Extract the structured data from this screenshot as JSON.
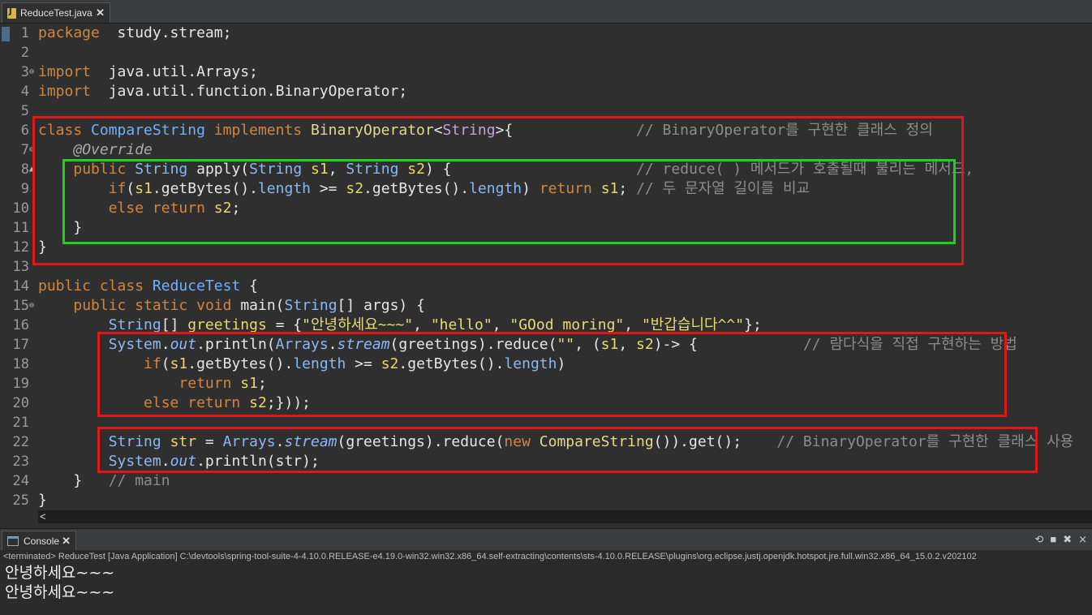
{
  "editor_tab": {
    "title": "ReduceTest.java",
    "icon": "java-file-icon"
  },
  "lines": [
    {
      "n": "1",
      "fold": "",
      "segs": [
        [
          "kw",
          "package"
        ],
        [
          "",
          "  study.stream;"
        ]
      ]
    },
    {
      "n": "2",
      "fold": "",
      "segs": []
    },
    {
      "n": "3",
      "fold": "⊖",
      "segs": [
        [
          "kw",
          "import"
        ],
        [
          "",
          "  java.util.Arrays;"
        ]
      ]
    },
    {
      "n": "4",
      "fold": "",
      "segs": [
        [
          "kw",
          "import"
        ],
        [
          "",
          "  java.util.function.BinaryOperator;"
        ]
      ]
    },
    {
      "n": "5",
      "fold": "",
      "segs": []
    },
    {
      "n": "6",
      "fold": "",
      "segs": [
        [
          "kw",
          "class"
        ],
        [
          "",
          " "
        ],
        [
          "cls",
          "CompareString"
        ],
        [
          "",
          " "
        ],
        [
          "kw",
          "implements"
        ],
        [
          "",
          " "
        ],
        [
          "iface",
          "BinaryOperator"
        ],
        [
          "",
          "<"
        ],
        [
          "gen",
          "String"
        ],
        [
          "",
          ">{"
        ],
        [
          "",
          "              "
        ],
        [
          "cmt",
          "// BinaryOperator를 구현한 클래스 정의"
        ]
      ]
    },
    {
      "n": "7",
      "fold": "⊖",
      "segs": [
        [
          "",
          "    "
        ],
        [
          "ann",
          "@Override"
        ]
      ]
    },
    {
      "n": "8",
      "fold": "▲",
      "segs": [
        [
          "",
          "    "
        ],
        [
          "kw",
          "public"
        ],
        [
          "",
          " "
        ],
        [
          "type",
          "String"
        ],
        [
          "",
          " "
        ],
        [
          "meth",
          "apply"
        ],
        [
          "",
          "("
        ],
        [
          "type",
          "String"
        ],
        [
          "",
          " "
        ],
        [
          "var",
          "s1"
        ],
        [
          "",
          ", "
        ],
        [
          "type",
          "String"
        ],
        [
          "",
          " "
        ],
        [
          "var",
          "s2"
        ],
        [
          "",
          ") {"
        ],
        [
          "",
          "                     "
        ],
        [
          "cmt",
          "// reduce( ) 메서드가 호출될때 불리는 메서드,"
        ]
      ]
    },
    {
      "n": "9",
      "fold": "",
      "segs": [
        [
          "",
          "        "
        ],
        [
          "kw",
          "if"
        ],
        [
          "",
          "("
        ],
        [
          "var",
          "s1"
        ],
        [
          "",
          ".getBytes()."
        ],
        [
          "fld2",
          "length"
        ],
        [
          "",
          " >= "
        ],
        [
          "var",
          "s2"
        ],
        [
          "",
          ".getBytes()."
        ],
        [
          "fld2",
          "length"
        ],
        [
          "",
          ") "
        ],
        [
          "kw",
          "return"
        ],
        [
          "",
          " "
        ],
        [
          "var",
          "s1"
        ],
        [
          "",
          "; "
        ],
        [
          "cmt",
          "// 두 문자열 길이를 비교"
        ]
      ]
    },
    {
      "n": "10",
      "fold": "",
      "segs": [
        [
          "",
          "        "
        ],
        [
          "kw",
          "else"
        ],
        [
          "",
          " "
        ],
        [
          "kw",
          "return"
        ],
        [
          "",
          " "
        ],
        [
          "var",
          "s2"
        ],
        [
          "",
          ";"
        ]
      ]
    },
    {
      "n": "11",
      "fold": "",
      "segs": [
        [
          "",
          "    }"
        ]
      ]
    },
    {
      "n": "12",
      "fold": "",
      "segs": [
        [
          "",
          "}"
        ]
      ]
    },
    {
      "n": "13",
      "fold": "",
      "segs": []
    },
    {
      "n": "14",
      "fold": "",
      "segs": [
        [
          "kw",
          "public"
        ],
        [
          "",
          " "
        ],
        [
          "kw",
          "class"
        ],
        [
          "",
          " "
        ],
        [
          "cls",
          "ReduceTest"
        ],
        [
          "",
          " {"
        ]
      ]
    },
    {
      "n": "15",
      "fold": "⊖",
      "segs": [
        [
          "",
          "    "
        ],
        [
          "kw",
          "public"
        ],
        [
          "",
          " "
        ],
        [
          "kw",
          "static"
        ],
        [
          "",
          " "
        ],
        [
          "kw",
          "void"
        ],
        [
          "",
          " "
        ],
        [
          "meth",
          "main"
        ],
        [
          "",
          "("
        ],
        [
          "type",
          "String"
        ],
        [
          "",
          "[] "
        ],
        [
          "meth",
          "args"
        ],
        [
          "",
          ") {"
        ]
      ]
    },
    {
      "n": "16",
      "fold": "",
      "segs": [
        [
          "",
          "        "
        ],
        [
          "type",
          "String"
        ],
        [
          "",
          "[] "
        ],
        [
          "var",
          "greetings"
        ],
        [
          "",
          " = {"
        ],
        [
          "str",
          "\"안녕하세요~~~\""
        ],
        [
          "",
          ", "
        ],
        [
          "str",
          "\"hello\""
        ],
        [
          "",
          ", "
        ],
        [
          "str",
          "\"GOod moring\""
        ],
        [
          "",
          ", "
        ],
        [
          "str",
          "\"반갑습니다^^\""
        ],
        [
          "",
          "};"
        ]
      ]
    },
    {
      "n": "17",
      "fold": "",
      "segs": [
        [
          "",
          "        "
        ],
        [
          "type",
          "System"
        ],
        [
          "",
          "."
        ],
        [
          "fld",
          "out"
        ],
        [
          "",
          ".println("
        ],
        [
          "type",
          "Arrays"
        ],
        [
          "",
          "."
        ],
        [
          "fld",
          "stream"
        ],
        [
          "",
          "(greetings).reduce("
        ],
        [
          "str",
          "\"\""
        ],
        [
          "",
          ", ("
        ],
        [
          "var",
          "s1"
        ],
        [
          "",
          ", "
        ],
        [
          "var",
          "s2"
        ],
        [
          "",
          ")-> {"
        ],
        [
          "",
          "            "
        ],
        [
          "cmt",
          "// 람다식을 직접 구현하는 방법"
        ]
      ]
    },
    {
      "n": "18",
      "fold": "",
      "segs": [
        [
          "",
          "            "
        ],
        [
          "kw",
          "if"
        ],
        [
          "",
          "("
        ],
        [
          "var",
          "s1"
        ],
        [
          "",
          ".getBytes()."
        ],
        [
          "fld2",
          "length"
        ],
        [
          "",
          " >= "
        ],
        [
          "var",
          "s2"
        ],
        [
          "",
          ".getBytes()."
        ],
        [
          "fld2",
          "length"
        ],
        [
          "",
          ")"
        ]
      ]
    },
    {
      "n": "19",
      "fold": "",
      "segs": [
        [
          "",
          "                "
        ],
        [
          "kw",
          "return"
        ],
        [
          "",
          " "
        ],
        [
          "var",
          "s1"
        ],
        [
          "",
          ";"
        ]
      ]
    },
    {
      "n": "20",
      "fold": "",
      "segs": [
        [
          "",
          "            "
        ],
        [
          "kw",
          "else"
        ],
        [
          "",
          " "
        ],
        [
          "kw",
          "return"
        ],
        [
          "",
          " "
        ],
        [
          "var",
          "s2"
        ],
        [
          "",
          ";}));"
        ]
      ]
    },
    {
      "n": "21",
      "fold": "",
      "segs": []
    },
    {
      "n": "22",
      "fold": "",
      "segs": [
        [
          "",
          "        "
        ],
        [
          "type",
          "String"
        ],
        [
          "",
          " "
        ],
        [
          "var",
          "str"
        ],
        [
          "",
          " = "
        ],
        [
          "type",
          "Arrays"
        ],
        [
          "",
          "."
        ],
        [
          "fld",
          "stream"
        ],
        [
          "",
          "(greetings).reduce("
        ],
        [
          "kw",
          "new"
        ],
        [
          "",
          " "
        ],
        [
          "iface",
          "CompareString"
        ],
        [
          "",
          "()).get();"
        ],
        [
          "",
          "    "
        ],
        [
          "cmt",
          "// BinaryOperator를 구현한 클래스 사용"
        ]
      ]
    },
    {
      "n": "23",
      "fold": "",
      "segs": [
        [
          "",
          "        "
        ],
        [
          "type",
          "System"
        ],
        [
          "",
          "."
        ],
        [
          "fld",
          "out"
        ],
        [
          "",
          ".println(str);"
        ]
      ]
    },
    {
      "n": "24",
      "fold": "",
      "segs": [
        [
          "",
          "    }"
        ],
        [
          "",
          "   "
        ],
        [
          "cmt",
          "// main"
        ]
      ]
    },
    {
      "n": "25",
      "fold": "",
      "segs": [
        [
          "",
          "}"
        ]
      ]
    }
  ],
  "hscroll_left": "<",
  "console": {
    "tab_title": "Console",
    "status": "<terminated> ReduceTest [Java Application] C:\\devtools\\spring-tool-suite-4-4.10.0.RELEASE-e4.19.0-win32.win32.x86_64.self-extracting\\contents\\sts-4.10.0.RELEASE\\plugins\\org.eclipse.justj.openjdk.hotspot.jre.full.win32.x86_64_15.0.2.v202102",
    "output": [
      "안녕하세요~~~",
      "안녕하세요~~~"
    ],
    "tools": [
      "⟲",
      "■",
      "✖",
      "⨯"
    ]
  }
}
